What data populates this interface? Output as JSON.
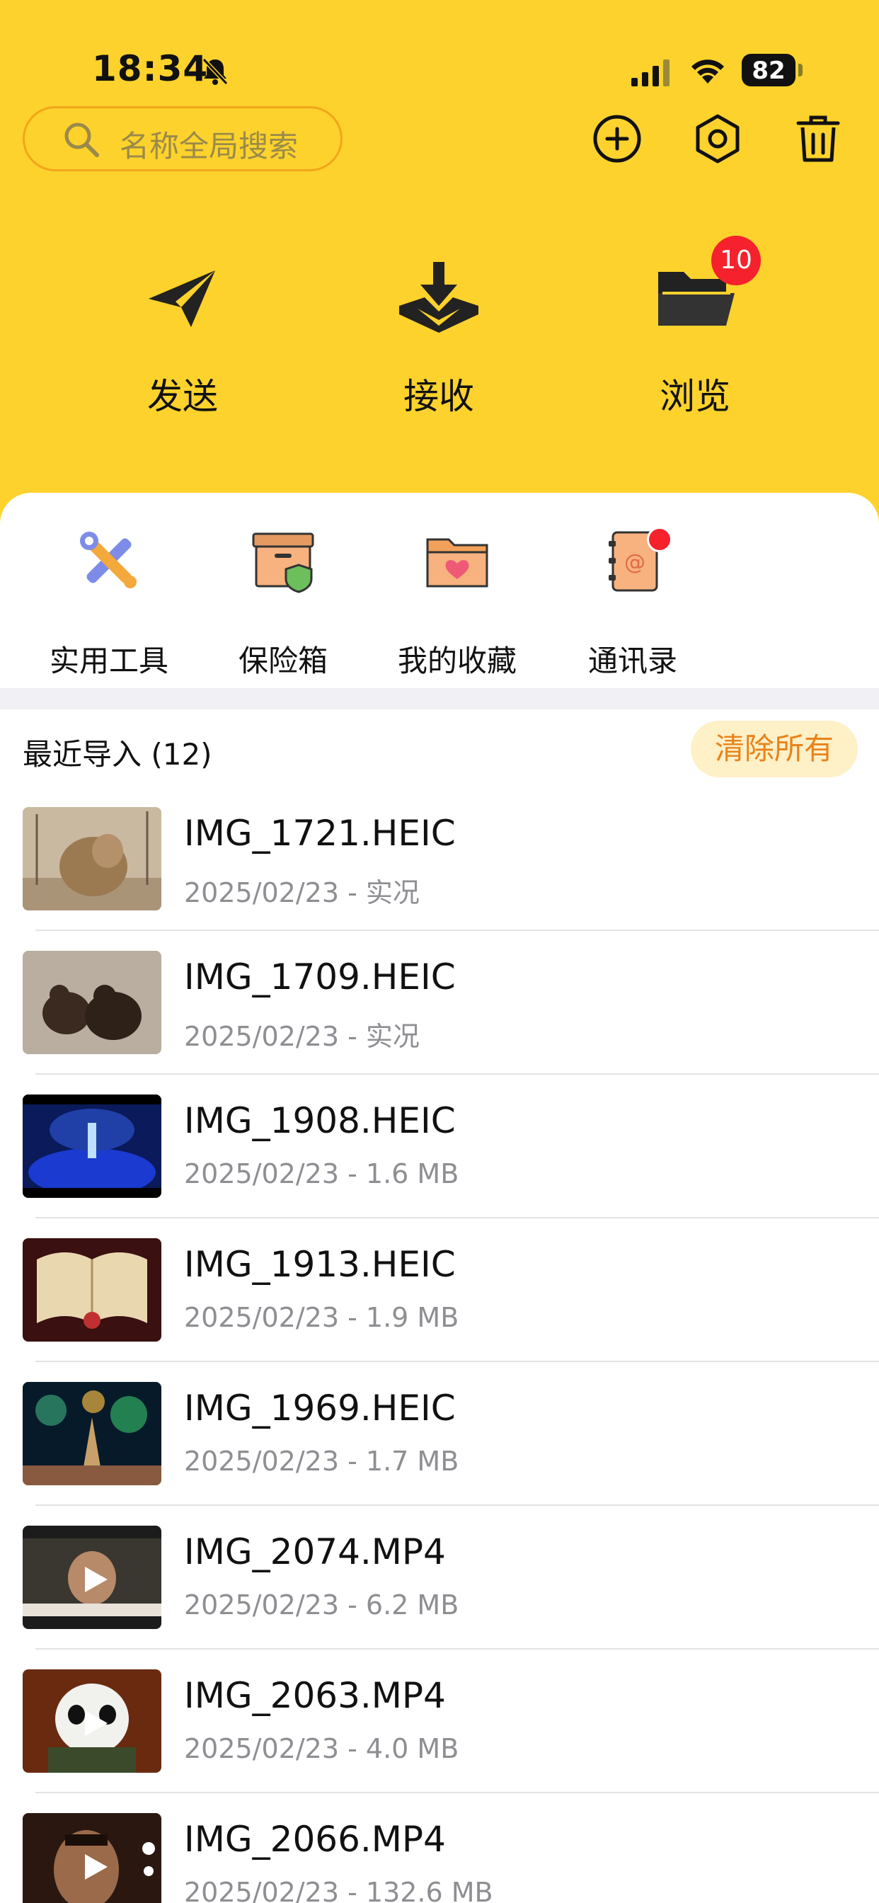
{
  "status_bar": {
    "time": "18:34",
    "battery": "82",
    "icons": [
      "bell-slash-icon",
      "signal-icon",
      "wifi-icon",
      "battery-icon"
    ]
  },
  "header": {
    "search_placeholder": "名称全局搜索",
    "icons": [
      "search-icon",
      "add-icon",
      "settings-icon",
      "trash-icon"
    ]
  },
  "actions": [
    {
      "label": "发送",
      "icon": "send-icon"
    },
    {
      "label": "接收",
      "icon": "receive-icon"
    },
    {
      "label": "浏览",
      "icon": "folder-icon",
      "badge": "10"
    }
  ],
  "tools": [
    {
      "label": "实用工具",
      "icon": "tools-icon"
    },
    {
      "label": "保险箱",
      "icon": "safe-box-icon"
    },
    {
      "label": "我的收藏",
      "icon": "favorites-folder-icon"
    },
    {
      "label": "通讯录",
      "icon": "contacts-book-icon",
      "dot": true
    }
  ],
  "recent": {
    "title": "最近导入 (12)",
    "clear_label": "清除所有",
    "items": [
      {
        "name": "IMG_1721.HEIC",
        "meta": "2025/02/23 - 实况",
        "video": false
      },
      {
        "name": "IMG_1709.HEIC",
        "meta": "2025/02/23 - 实况",
        "video": false
      },
      {
        "name": "IMG_1908.HEIC",
        "meta": "2025/02/23 - 1.6 MB",
        "video": false
      },
      {
        "name": "IMG_1913.HEIC",
        "meta": "2025/02/23 - 1.9 MB",
        "video": false
      },
      {
        "name": "IMG_1969.HEIC",
        "meta": "2025/02/23 - 1.7 MB",
        "video": false
      },
      {
        "name": "IMG_2074.MP4",
        "meta": "2025/02/23 - 6.2 MB",
        "video": true
      },
      {
        "name": "IMG_2063.MP4",
        "meta": "2025/02/23 - 4.0 MB",
        "video": true
      },
      {
        "name": "IMG_2066.MP4",
        "meta": "2025/02/23 - 132.6 MB",
        "video": true
      }
    ]
  },
  "colors": {
    "header_bg": "#FDD22C",
    "accent_orange": "#E8831A",
    "badge_red": "#F5222D",
    "clear_bg": "#FEF0C7"
  }
}
